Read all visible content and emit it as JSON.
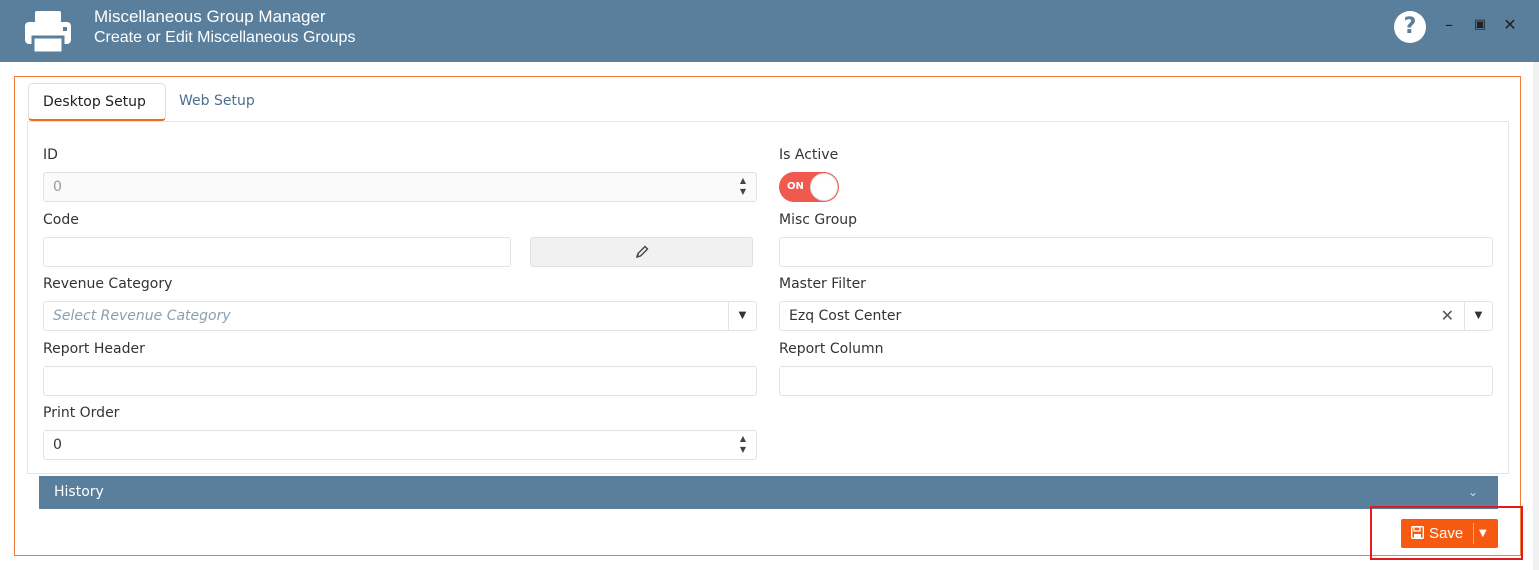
{
  "window": {
    "title": "Miscellaneous Group Manager",
    "subtitle": "Create or Edit Miscellaneous Groups",
    "help_glyph": "?",
    "minimize_glyph": "–",
    "maximize_glyph": "▣",
    "close_glyph": "✕",
    "logo_icon": "printer-icon"
  },
  "tabs": [
    {
      "label": "Desktop Setup",
      "active": true
    },
    {
      "label": "Web Setup",
      "active": false
    }
  ],
  "form": {
    "id": {
      "label": "ID",
      "value": "0"
    },
    "code": {
      "label": "Code",
      "value": ""
    },
    "revenue_category": {
      "label": "Revenue Category",
      "placeholder": "Select Revenue Category",
      "value": ""
    },
    "report_header": {
      "label": "Report Header",
      "value": ""
    },
    "print_order": {
      "label": "Print Order",
      "value": "0"
    },
    "is_active": {
      "label": "Is Active",
      "state_text": "ON",
      "on": true
    },
    "misc_group": {
      "label": "Misc Group",
      "value": ""
    },
    "master_filter": {
      "label": "Master Filter",
      "value": "Ezq Cost Center"
    },
    "report_column": {
      "label": "Report Column",
      "value": ""
    }
  },
  "glyphs": {
    "spin_up": "▲",
    "spin_down": "▼",
    "dropdown": "▼",
    "clear": "✕",
    "chevron": "⌄"
  },
  "history": {
    "label": "History"
  },
  "actions": {
    "save_label": "Save",
    "dropdown_glyph": "▼"
  },
  "colors": {
    "header": "#5a7f9c",
    "accent": "#f55a10",
    "toggle_on": "#f05a4e",
    "highlight": "#e21c1c"
  }
}
